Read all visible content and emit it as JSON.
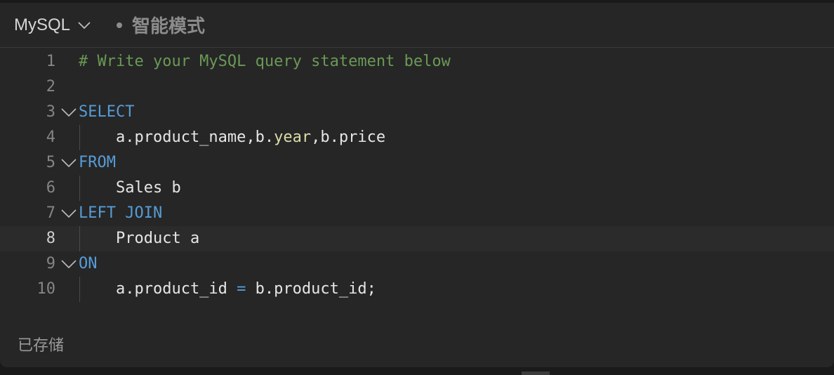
{
  "toolbar": {
    "language": "MySQL",
    "mode_label": "智能模式"
  },
  "editor": {
    "lines": [
      {
        "number": "1",
        "tokens": [
          {
            "t": "# Write your MySQL query statement below",
            "c": "comment"
          }
        ]
      },
      {
        "number": "2",
        "tokens": []
      },
      {
        "number": "3",
        "tokens": [
          {
            "t": "SELECT",
            "c": "kw"
          }
        ]
      },
      {
        "number": "4",
        "tokens": [
          {
            "t": "    a.product_name,b.",
            "c": "plain"
          },
          {
            "t": "year",
            "c": "fn"
          },
          {
            "t": ",b.price",
            "c": "plain"
          }
        ]
      },
      {
        "number": "5",
        "tokens": [
          {
            "t": "FROM",
            "c": "kw"
          }
        ]
      },
      {
        "number": "6",
        "tokens": [
          {
            "t": "    Sales b",
            "c": "plain"
          }
        ]
      },
      {
        "number": "7",
        "tokens": [
          {
            "t": "LEFT JOIN",
            "c": "kw"
          }
        ]
      },
      {
        "number": "8",
        "tokens": [
          {
            "t": "    Product a",
            "c": "plain"
          }
        ]
      },
      {
        "number": "9",
        "tokens": [
          {
            "t": "ON",
            "c": "kw"
          }
        ]
      },
      {
        "number": "10",
        "tokens": [
          {
            "t": "    a.product_id ",
            "c": "plain"
          },
          {
            "t": "=",
            "c": "op"
          },
          {
            "t": " b.product_id;",
            "c": "plain"
          }
        ]
      }
    ],
    "current_line": "8"
  },
  "footer": {
    "status": "已存储"
  },
  "colors": {
    "background": "#262626",
    "keyword": "#569cd6",
    "comment": "#6a9955",
    "function": "#dcdcaa"
  }
}
